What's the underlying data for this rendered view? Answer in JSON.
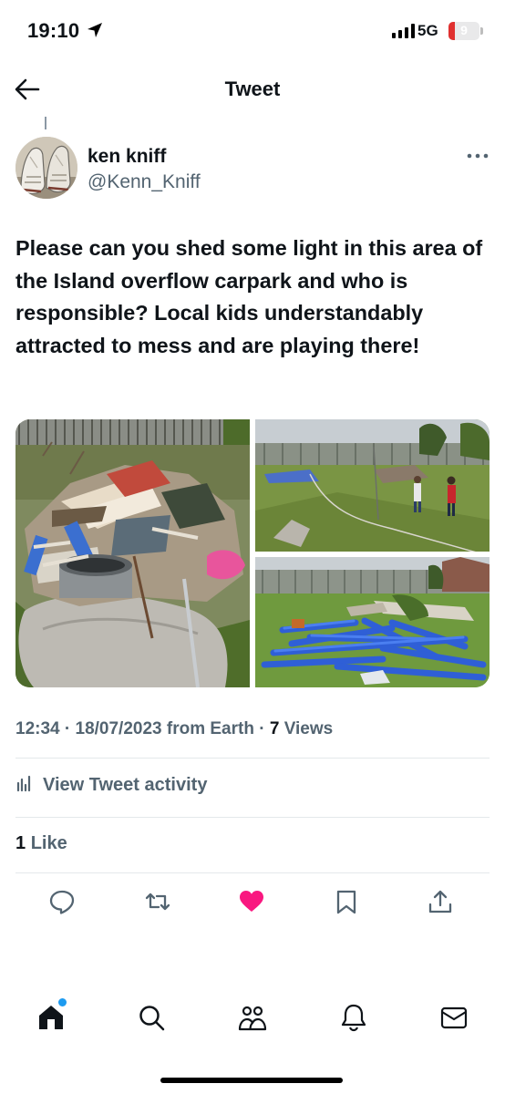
{
  "status_bar": {
    "time": "19:10",
    "network": "5G",
    "battery": "9",
    "battery_level": 0.09
  },
  "header": {
    "title": "Tweet"
  },
  "author": {
    "name": "ken kniff",
    "handle": "@Kenn_Kniff"
  },
  "tweet": {
    "text": "Please can you shed some light in this area of the Island overflow carpark and who is responsible? Local kids understandably attracted to mess and are playing there!",
    "time": "12:34",
    "date": "18/07/2023",
    "source": "from Earth",
    "views_count": "7",
    "views_label": "Views",
    "separator": "·"
  },
  "activity": {
    "label": "View Tweet activity"
  },
  "likes": {
    "count": "1",
    "label": "Like"
  },
  "actions": [
    "reply",
    "retweet",
    "like",
    "bookmark",
    "share"
  ],
  "tab_bar": [
    "home",
    "search",
    "communities",
    "notifications",
    "messages"
  ],
  "colors": {
    "accent": "#1d9bf0",
    "like": "#f91880",
    "text": "#0f1419",
    "secondary": "#536471"
  }
}
